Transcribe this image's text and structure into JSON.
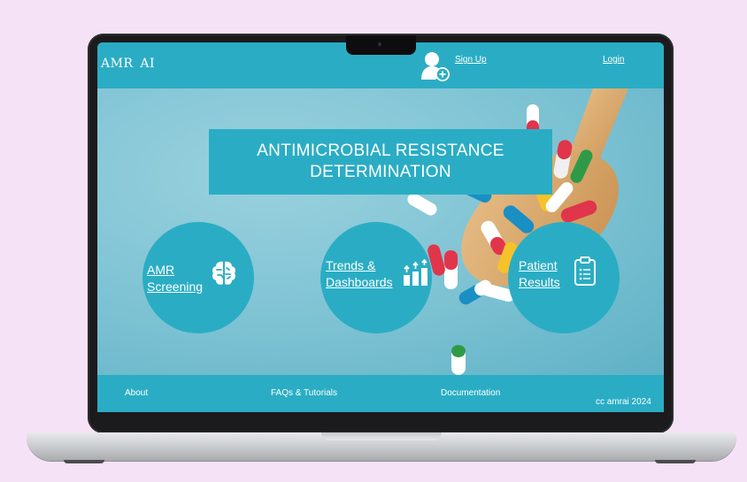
{
  "header": {
    "logo": "AMR AI",
    "signup_label": "Sign Up",
    "login_label": "Login"
  },
  "hero": {
    "title": "ANTIMICROBIAL RESISTANCE DETERMINATION"
  },
  "features": [
    {
      "line1": "AMR",
      "line2": "Screening",
      "icon": "brain-icon"
    },
    {
      "line1": "Trends &",
      "line2": "Dashboards",
      "icon": "bar-chart-icon"
    },
    {
      "line1": "Patient",
      "line2": "Results",
      "icon": "clipboard-icon"
    }
  ],
  "footer": {
    "about": "About",
    "faqs": "FAQs & Tutorials",
    "documentation": "Documentation",
    "copyright": "cc amrai 2024"
  },
  "colors": {
    "accent": "#2aadc4",
    "background": "#f6e2f6",
    "text": "#ffffff"
  }
}
